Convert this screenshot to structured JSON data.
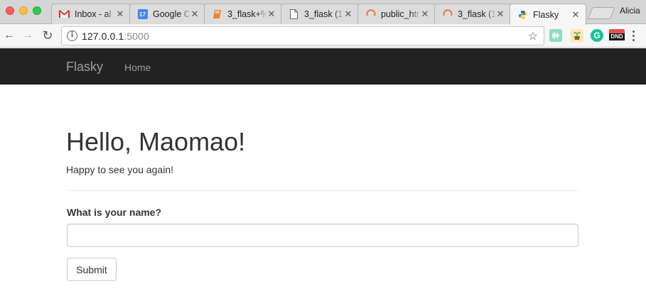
{
  "browser": {
    "tabs": [
      {
        "title": "Inbox - al",
        "icon": "gmail-icon"
      },
      {
        "title": "Google C",
        "icon": "calendar-icon",
        "icon_text": "17"
      },
      {
        "title": "3_flask+%",
        "icon": "book-icon"
      },
      {
        "title": "3_flask (1",
        "icon": "document-icon"
      },
      {
        "title": "public_htr",
        "icon": "loading-icon"
      },
      {
        "title": "3_flask (1",
        "icon": "loading-icon"
      },
      {
        "title": "Flasky",
        "icon": "python-icon",
        "active": true
      }
    ],
    "close_glyph": "✕",
    "profile_name": "Alicia",
    "url_host": "127.0.0.1",
    "url_port": ":5000",
    "info_glyph": "i",
    "bookmark_glyph": "☆",
    "extensions": {
      "grammarly": "G",
      "dnd": "DND"
    },
    "nav_glyphs": {
      "back": "←",
      "forward": "→",
      "reload": "↻"
    }
  },
  "navbar": {
    "brand": "Flasky",
    "links": [
      "Home"
    ]
  },
  "main": {
    "heading": "Hello, Maomao!",
    "subtitle": "Happy to see you again!",
    "form": {
      "label": "What is your name?",
      "input_value": "",
      "submit_label": "Submit"
    }
  },
  "colors": {
    "navbar_bg": "#222222",
    "navbar_text": "#9d9d9d",
    "body_text": "#333333"
  }
}
